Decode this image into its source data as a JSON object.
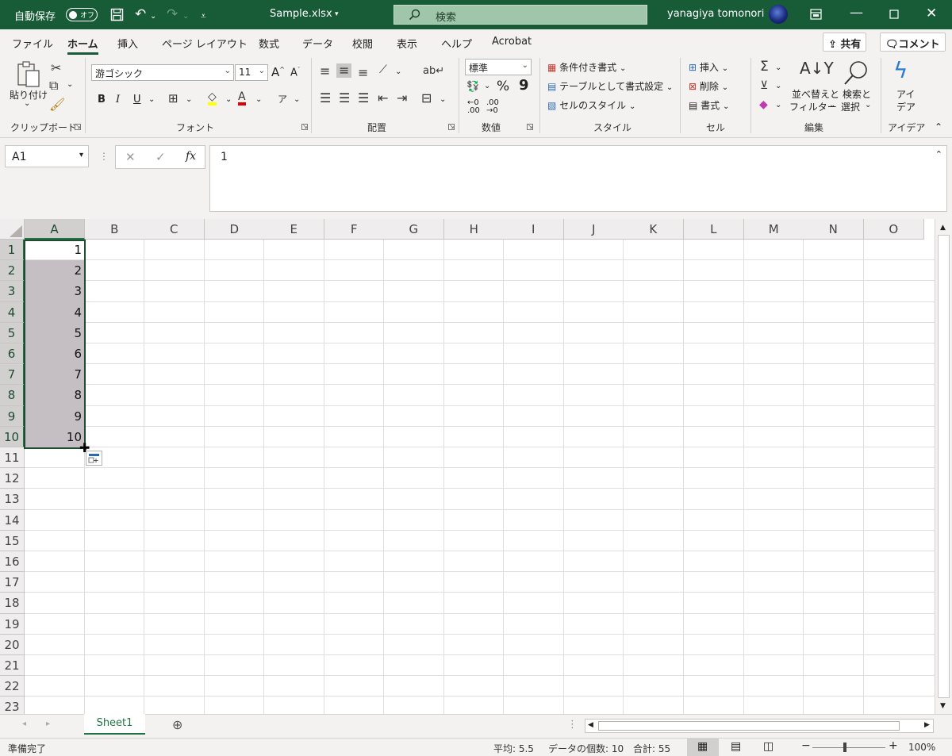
{
  "titlebar": {
    "autosave_label": "自動保存",
    "autosave_state": "オフ",
    "file_name": "Sample.xlsx",
    "search_placeholder": "検索",
    "user_name": "yanagiya tomonori"
  },
  "menu": {
    "items": [
      "ファイル",
      "ホーム",
      "挿入",
      "ページ レイアウト",
      "数式",
      "データ",
      "校閲",
      "表示",
      "ヘルプ",
      "Acrobat"
    ],
    "share_label": "共有",
    "comment_label": "コメント"
  },
  "ribbon": {
    "clipboard": {
      "paste": "貼り付け",
      "group": "クリップボード"
    },
    "font": {
      "family": "游ゴシック",
      "size": "11",
      "group": "フォント",
      "bold": "B",
      "italic": "I",
      "underline": "U"
    },
    "alignment": {
      "group": "配置"
    },
    "number": {
      "format": "標準",
      "percent": "%",
      "comma": "9",
      "group": "数値"
    },
    "styles": {
      "conditional": "条件付き書式",
      "as_table": "テーブルとして書式設定",
      "cell_styles": "セルのスタイル",
      "group": "スタイル"
    },
    "cells": {
      "insert": "挿入",
      "delete": "削除",
      "format": "書式",
      "group": "セル"
    },
    "editing": {
      "sort_line1": "並べ替えと",
      "sort_line2": "フィルター",
      "find_line1": "検索と",
      "find_line2": "選択",
      "group": "編集"
    },
    "ideas": {
      "line1": "アイ",
      "line2": "デア",
      "group": "アイデア"
    }
  },
  "formula_bar": {
    "name_box": "A1",
    "fx": "fx",
    "content": "1"
  },
  "sheet": {
    "columns": [
      "A",
      "B",
      "C",
      "D",
      "E",
      "F",
      "G",
      "H",
      "I",
      "J",
      "K",
      "L",
      "M",
      "N",
      "O"
    ],
    "rows": [
      "1",
      "2",
      "3",
      "4",
      "5",
      "6",
      "7",
      "8",
      "9",
      "10",
      "11",
      "12",
      "13",
      "14",
      "15",
      "16",
      "17",
      "18",
      "19",
      "20",
      "21",
      "22",
      "23"
    ],
    "a_values": [
      "1",
      "2",
      "3",
      "4",
      "5",
      "6",
      "7",
      "8",
      "9",
      "10"
    ]
  },
  "tabs": {
    "sheet1": "Sheet1"
  },
  "status": {
    "ready": "準備完了",
    "average": "平均: 5.5",
    "count": "データの個数: 10",
    "sum": "合計: 55",
    "zoom": "100%"
  },
  "colors": {
    "title_green": "#185c37",
    "accent_green": "#217346",
    "selection": "#c5bfc3"
  }
}
